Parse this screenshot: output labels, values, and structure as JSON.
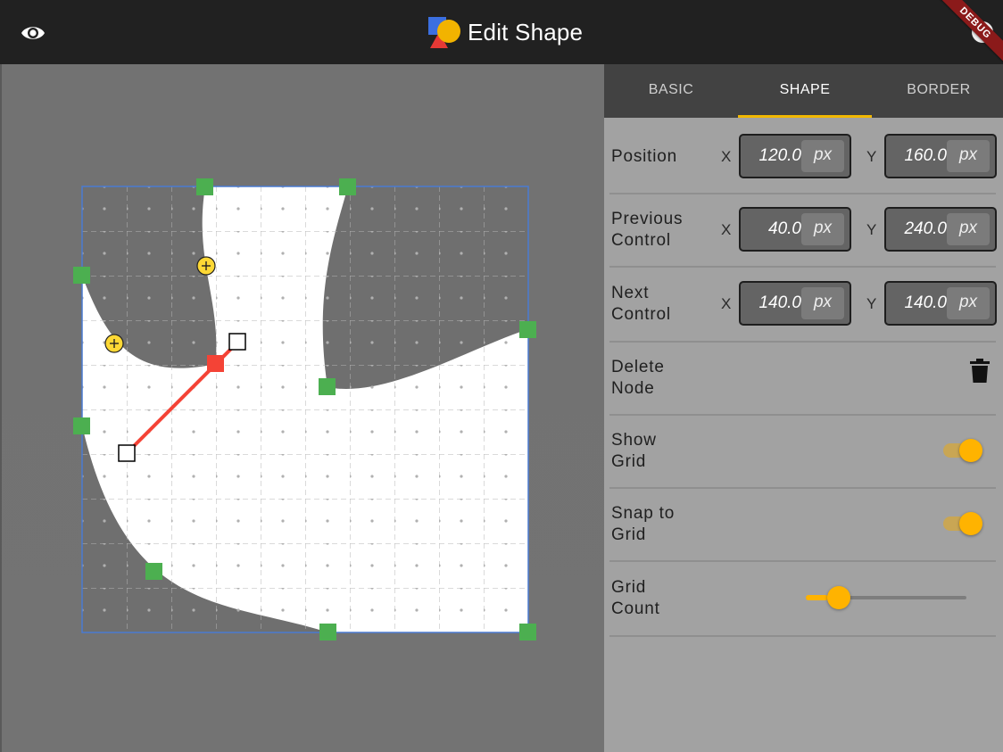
{
  "app": {
    "title": "Edit Shape",
    "debug_banner": "DEBUG"
  },
  "tabs": [
    {
      "label": "BASIC",
      "active": false
    },
    {
      "label": "SHAPE",
      "active": true
    },
    {
      "label": "BORDER",
      "active": false
    }
  ],
  "properties": {
    "position": {
      "label": "Position",
      "x_axis": "X",
      "y_axis": "Y",
      "x": "120.0",
      "y": "160.0",
      "unit": "px"
    },
    "previous_control": {
      "label": "Previous\nControl",
      "x_axis": "X",
      "y_axis": "Y",
      "x": "40.0",
      "y": "240.0",
      "unit": "px"
    },
    "next_control": {
      "label": "Next\nControl",
      "x_axis": "X",
      "y_axis": "Y",
      "x": "140.0",
      "y": "140.0",
      "unit": "px"
    },
    "delete_node": {
      "label": "Delete\nNode"
    },
    "show_grid": {
      "label": "Show\nGrid",
      "on": true
    },
    "snap_to_grid": {
      "label": "Snap to\nGrid",
      "on": true
    },
    "grid_count": {
      "label": "Grid\nCount",
      "fraction": 0.14
    }
  },
  "colors": {
    "accent": "#ffb300",
    "node": "#4caf50",
    "selected_node": "#f44336",
    "control_line": "#f44336",
    "add_node": "#fdd835",
    "bounds": "#4a7bd1"
  },
  "icons": {
    "visibility": "eye-icon",
    "logo": "shapes-logo-icon",
    "account": "avatar-icon",
    "delete": "trash-icon",
    "add_node": "plus-circle-icon"
  }
}
